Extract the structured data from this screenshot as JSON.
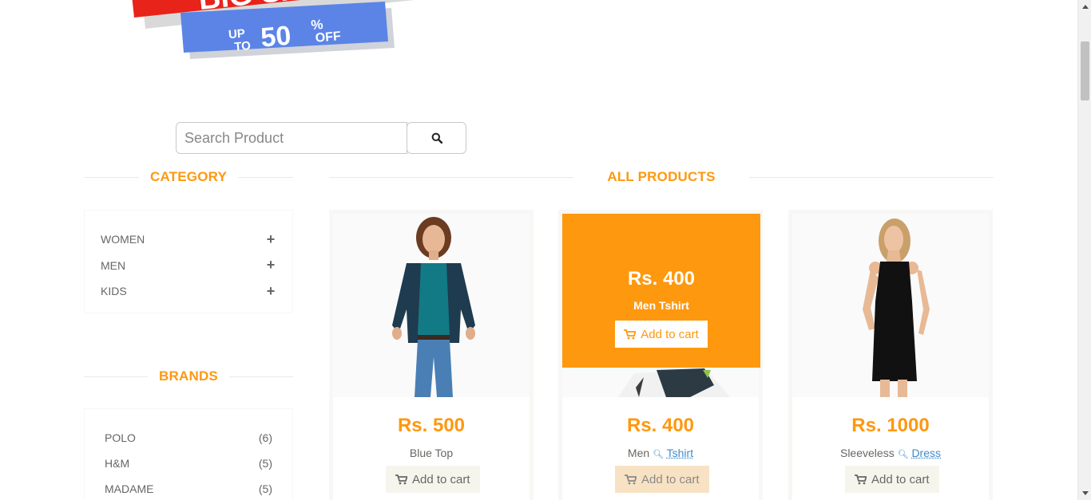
{
  "banner": {
    "headline": "BIG SALE",
    "up_to": "UP TO",
    "percent": "50",
    "percent_sign": "%",
    "off": "OFF"
  },
  "search": {
    "placeholder": "Search Product"
  },
  "category": {
    "title": "CATEGORY",
    "items": [
      {
        "label": "WOMEN"
      },
      {
        "label": "MEN"
      },
      {
        "label": "KIDS"
      }
    ]
  },
  "brands": {
    "title": "BRANDS",
    "items": [
      {
        "name": "POLO",
        "count": "(6)"
      },
      {
        "name": "H&M",
        "count": "(5)"
      },
      {
        "name": "MADAME",
        "count": "(5)"
      }
    ]
  },
  "products": {
    "title": "ALL PRODUCTS",
    "add_to_cart": "Add to cart",
    "items": [
      {
        "price": "Rs. 500",
        "name": "Blue Top"
      },
      {
        "price": "Rs. 400",
        "name_prefix": "Men",
        "name_keyword": "Tshirt",
        "overlay_price": "Rs. 400",
        "overlay_name": "Men Tshirt"
      },
      {
        "price": "Rs. 1000",
        "name_prefix": "Sleeveless",
        "name_keyword": "Dress"
      }
    ]
  },
  "colors": {
    "accent": "#fe980f",
    "link": "#428bca",
    "text": "#696763"
  }
}
